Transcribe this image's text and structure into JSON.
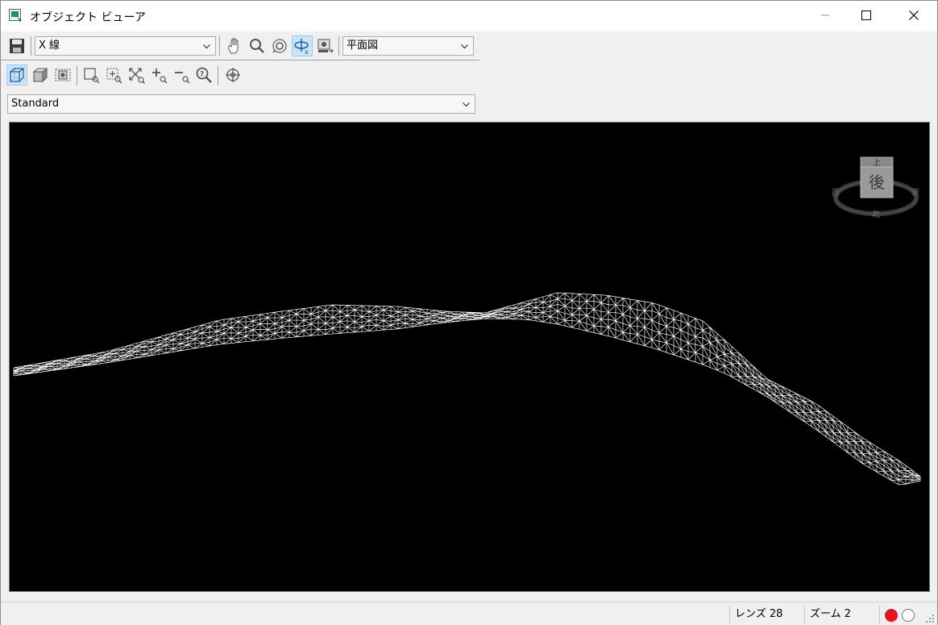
{
  "window": {
    "title": "オブジェクト ビューア"
  },
  "toolbar": {
    "line_select_value": "X 線",
    "view_select_value": "平面図",
    "style_select_value": "Standard"
  },
  "viewcube": {
    "face_label": "後",
    "top_label": "上",
    "compass_left": "西",
    "compass_right": "東",
    "compass_bottom": "北"
  },
  "status": {
    "lens": "レンズ 28",
    "zoom": "ズーム 2"
  },
  "colors": {
    "viewport_bg": "#000000",
    "mesh": "#ffffff",
    "record_red": "#e81123",
    "active_tool": "#cce4f7"
  },
  "icons": {
    "save": "save-icon",
    "pan": "pan-hand-icon",
    "zoom": "zoom-icon",
    "orbit": "orbit-icon",
    "rotate": "rotate-x-icon",
    "camera": "camera-icon",
    "wireframe": "wireframe-cube-icon",
    "shaded": "shaded-cube-icon",
    "snapshot": "snapshot-icon",
    "zoom_window": "zoom-window-icon",
    "zoom_center": "zoom-center-icon",
    "zoom_extents": "zoom-extents-icon",
    "zoom_in": "zoom-in-icon",
    "zoom_out": "zoom-out-icon",
    "zoom_help": "zoom-question-icon",
    "target": "target-icon"
  }
}
